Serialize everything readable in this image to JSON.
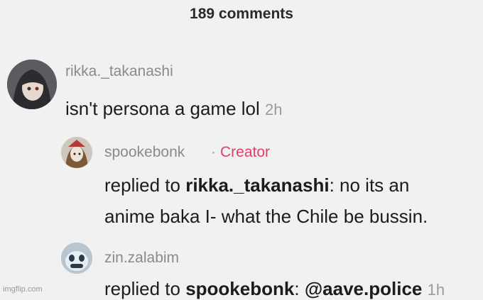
{
  "header": {
    "comment_count": "189 comments"
  },
  "comments": [
    {
      "username": "rikka._takanashi",
      "text": "isn't persona a game lol",
      "time": "2h"
    },
    {
      "username": "spookebonk",
      "separator": "·",
      "badge": "Creator",
      "reply_prefix": "replied to",
      "reply_target": "rikka._takanashi",
      "reply_colon": ":",
      "text_line1": "no its an",
      "text_line2": "anime baka I- what the Chile be bussin."
    },
    {
      "username": "zin.zalabim",
      "reply_prefix": "replied to",
      "reply_target": "spookebonk",
      "reply_colon": ":",
      "mention": "@aave.police",
      "time": "1h"
    }
  ],
  "watermark": "imgflip.com",
  "colors": {
    "background": "#f1f1f1",
    "creator_badge": "#e0406a",
    "muted": "#8a8a8a"
  }
}
